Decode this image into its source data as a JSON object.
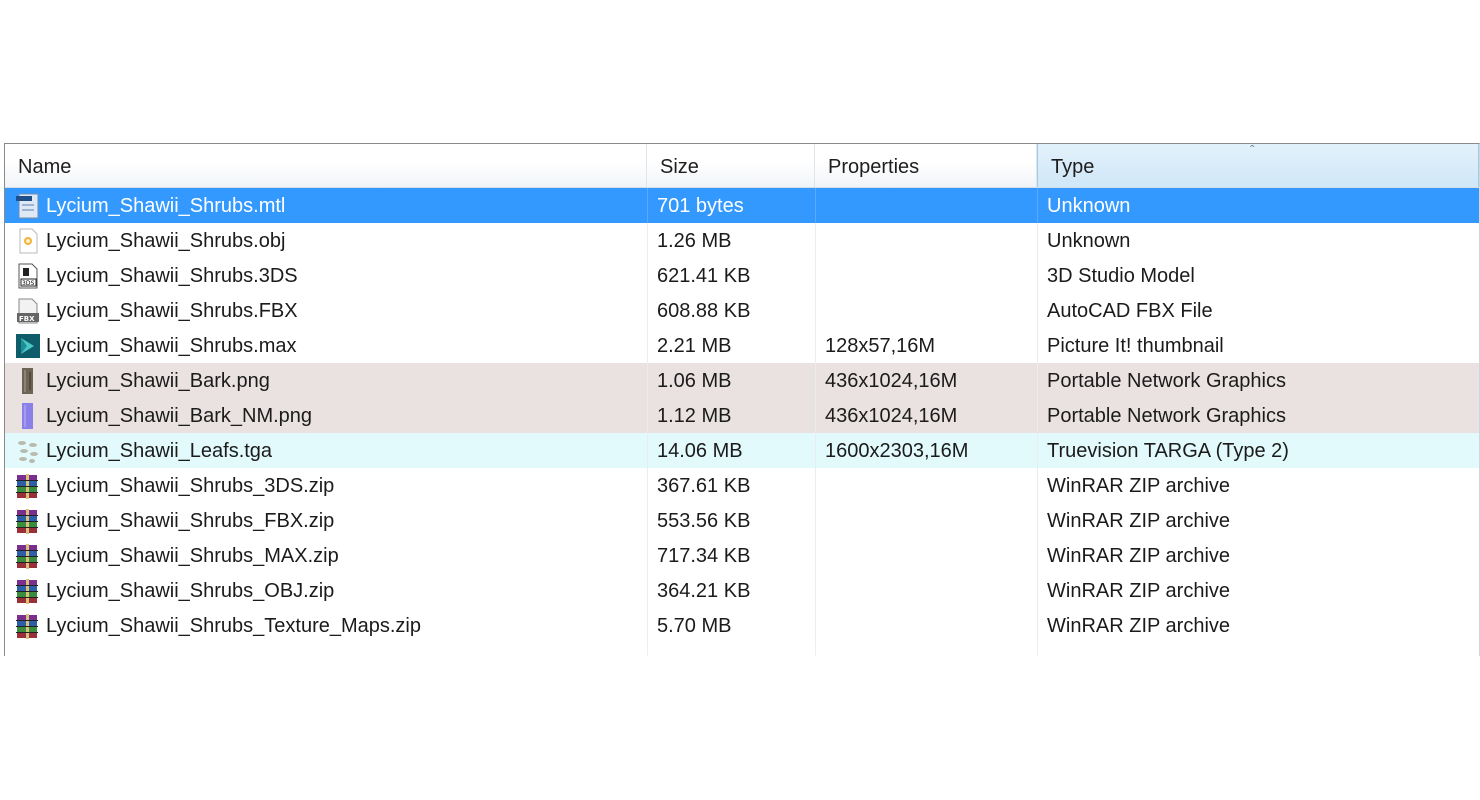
{
  "columns": {
    "name": "Name",
    "size": "Size",
    "properties": "Properties",
    "type": "Type",
    "sort_indicator": "ˆ"
  },
  "files": [
    {
      "name": "Lycium_Shawii_Shrubs.mtl",
      "size": "701 bytes",
      "properties": "",
      "type": "Unknown",
      "icon": "mtl-file-icon",
      "state": "selected"
    },
    {
      "name": "Lycium_Shawii_Shrubs.obj",
      "size": "1.26 MB",
      "properties": "",
      "type": "Unknown",
      "icon": "obj-file-icon",
      "state": ""
    },
    {
      "name": "Lycium_Shawii_Shrubs.3DS",
      "size": "621.41 KB",
      "properties": "",
      "type": "3D Studio Model",
      "icon": "3ds-file-icon",
      "state": ""
    },
    {
      "name": "Lycium_Shawii_Shrubs.FBX",
      "size": "608.88 KB",
      "properties": "",
      "type": "AutoCAD FBX File",
      "icon": "fbx-file-icon",
      "state": ""
    },
    {
      "name": "Lycium_Shawii_Shrubs.max",
      "size": "2.21 MB",
      "properties": "128x57,16M",
      "type": "Picture It! thumbnail",
      "icon": "3dsmax-file-icon",
      "state": ""
    },
    {
      "name": "Lycium_Shawii_Bark.png",
      "size": "1.06 MB",
      "properties": "436x1024,16M",
      "type": "Portable Network Graphics",
      "icon": "bark-texture-icon",
      "state": "tint-a"
    },
    {
      "name": "Lycium_Shawii_Bark_NM.png",
      "size": "1.12 MB",
      "properties": "436x1024,16M",
      "type": "Portable Network Graphics",
      "icon": "normal-map-icon",
      "state": "tint-a"
    },
    {
      "name": "Lycium_Shawii_Leafs.tga",
      "size": "14.06 MB",
      "properties": "1600x2303,16M",
      "type": "Truevision TARGA (Type 2)",
      "icon": "leaf-texture-icon",
      "state": "tint-b"
    },
    {
      "name": "Lycium_Shawii_Shrubs_3DS.zip",
      "size": "367.61 KB",
      "properties": "",
      "type": "WinRAR ZIP archive",
      "icon": "winrar-archive-icon",
      "state": ""
    },
    {
      "name": "Lycium_Shawii_Shrubs_FBX.zip",
      "size": "553.56 KB",
      "properties": "",
      "type": "WinRAR ZIP archive",
      "icon": "winrar-archive-icon",
      "state": ""
    },
    {
      "name": "Lycium_Shawii_Shrubs_MAX.zip",
      "size": "717.34 KB",
      "properties": "",
      "type": "WinRAR ZIP archive",
      "icon": "winrar-archive-icon",
      "state": ""
    },
    {
      "name": "Lycium_Shawii_Shrubs_OBJ.zip",
      "size": "364.21 KB",
      "properties": "",
      "type": "WinRAR ZIP archive",
      "icon": "winrar-archive-icon",
      "state": ""
    },
    {
      "name": "Lycium_Shawii_Shrubs_Texture_Maps.zip",
      "size": "5.70 MB",
      "properties": "",
      "type": "WinRAR ZIP archive",
      "icon": "winrar-archive-icon",
      "state": ""
    }
  ],
  "colors": {
    "selection": "#3399ff",
    "tint_png": "#e9e2e0",
    "tint_tga": "#e3fafc"
  }
}
